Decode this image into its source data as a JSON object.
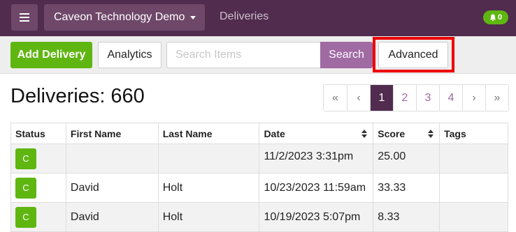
{
  "header": {
    "app_name": "Caveon Technology Demo",
    "nav_label": "Deliveries",
    "notification_count": "0",
    "menu_icon": "hamburger-icon",
    "bell_icon": "bell-icon"
  },
  "toolbar": {
    "add_label": "Add Delivery",
    "analytics_label": "Analytics",
    "search_placeholder": "Search Items",
    "search_label": "Search",
    "advanced_label": "Advanced"
  },
  "page": {
    "title": "Deliveries: 660"
  },
  "pagination": {
    "first": "«",
    "prev": "‹",
    "pages": [
      "1",
      "2",
      "3",
      "4"
    ],
    "current": "1",
    "next": "›",
    "last": "»"
  },
  "table": {
    "columns": [
      "Status",
      "First Name",
      "Last Name",
      "Date",
      "Score",
      "Tags"
    ],
    "rows": [
      {
        "status": "C",
        "first_name": "",
        "last_name": "",
        "date": "11/2/2023 3:31pm",
        "score": "25.00",
        "tags": ""
      },
      {
        "status": "C",
        "first_name": "David",
        "last_name": "Holt",
        "date": "10/23/2023 11:59am",
        "score": "33.33",
        "tags": ""
      },
      {
        "status": "C",
        "first_name": "David",
        "last_name": "Holt",
        "date": "10/19/2023 5:07pm",
        "score": "8.33",
        "tags": ""
      }
    ]
  },
  "colors": {
    "header_bg": "#512c4e",
    "accent_purple": "#a06aa3",
    "success_green": "#5fb611",
    "highlight_red": "#ee0000"
  }
}
